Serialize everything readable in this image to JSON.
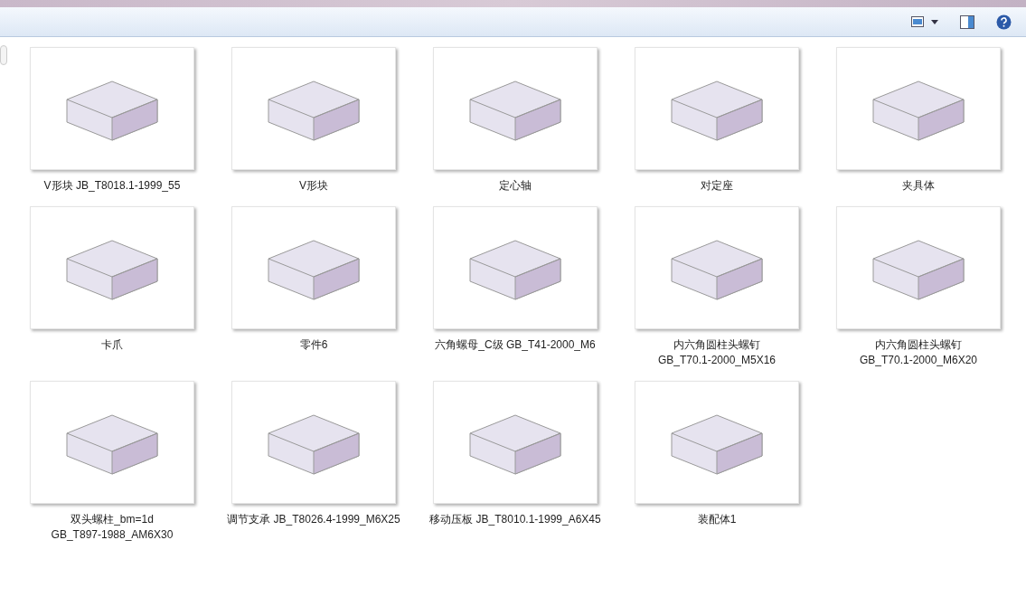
{
  "items": [
    {
      "name": "V形块 JB_T8018.1-1999_55"
    },
    {
      "name": "V形块"
    },
    {
      "name": "定心轴"
    },
    {
      "name": "对定座"
    },
    {
      "name": "夹具体"
    },
    {
      "name": "卡爪"
    },
    {
      "name": "零件6"
    },
    {
      "name": "六角螺母_C级 GB_T41-2000_M6"
    },
    {
      "name": "内六角圆柱头螺钉\nGB_T70.1-2000_M5X16"
    },
    {
      "name": "内六角圆柱头螺钉\nGB_T70.1-2000_M6X20"
    },
    {
      "name": "双头螺柱_bm=1d\nGB_T897-1988_AM6X30"
    },
    {
      "name": "调节支承 JB_T8026.4-1999_M6X25"
    },
    {
      "name": "移动压板 JB_T8010.1-1999_A6X45"
    },
    {
      "name": "装配体1"
    }
  ]
}
